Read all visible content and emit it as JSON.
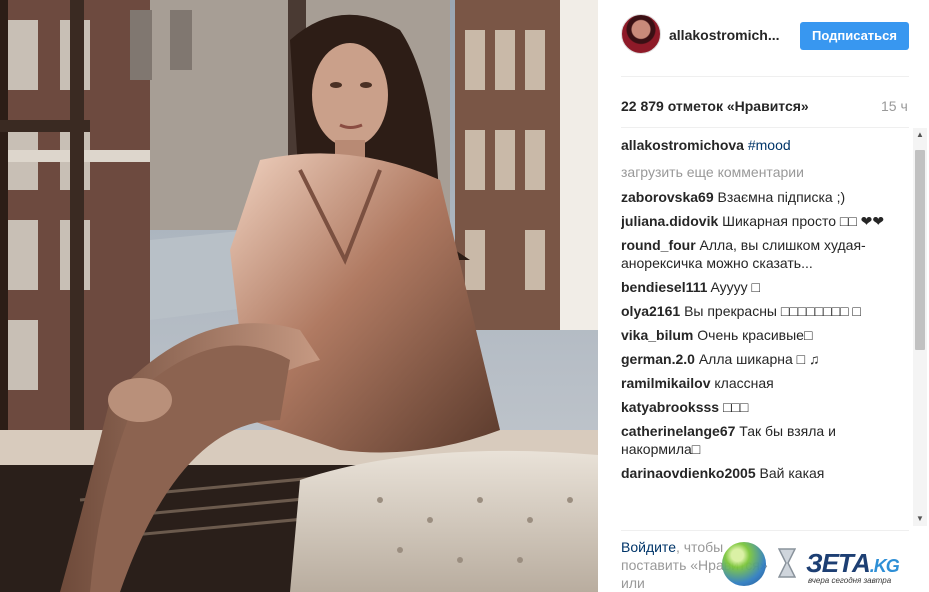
{
  "post": {
    "username": "allakostromich...",
    "follow_label": "Подписаться",
    "likes": "22 879 отметок «Нравится»",
    "time": "15 ч"
  },
  "caption": {
    "user": "allakostromichova",
    "tag": "#mood"
  },
  "load_more": "загрузить еще комментарии",
  "comments": [
    {
      "user": "zaborovska69",
      "text": "Взаємна підписка ;)"
    },
    {
      "user": "juliana.didovik",
      "text": "Шикарная просто □□ ❤❤"
    },
    {
      "user": "round_four",
      "text": "Алла, вы слишком худая- анорексичка можно сказать..."
    },
    {
      "user": "bendiesel111",
      "text": "Ayyyy □"
    },
    {
      "user": "olya2161",
      "text": "Вы прекрасны □□□□□□□□ □"
    },
    {
      "user": "vika_bilum",
      "text": "Очень красивые□"
    },
    {
      "user": "german.2.0",
      "text": "Алла шикарна □ ♫"
    },
    {
      "user": "ramilmikailov",
      "text": "классная"
    },
    {
      "user": "katyabrooksss",
      "text": "□□□"
    },
    {
      "user": "catherinelange67",
      "text": "Так бы взяла и накормила□"
    },
    {
      "user": "darinaovdienko2005",
      "text": "Вай какая"
    }
  ],
  "footer": {
    "login_link": "Войдите",
    "text": ", чтобы поставить «Нравится» или прокомментировать."
  },
  "watermark": {
    "name": "ЗЕТА",
    "domain": ".KG",
    "slogan": "вчера сегодня завтра"
  },
  "colors": {
    "accent": "#3897f0",
    "link": "#003569",
    "muted": "#999999"
  },
  "icons": {
    "scroll_up": "triangle-up",
    "scroll_down": "triangle-down"
  }
}
